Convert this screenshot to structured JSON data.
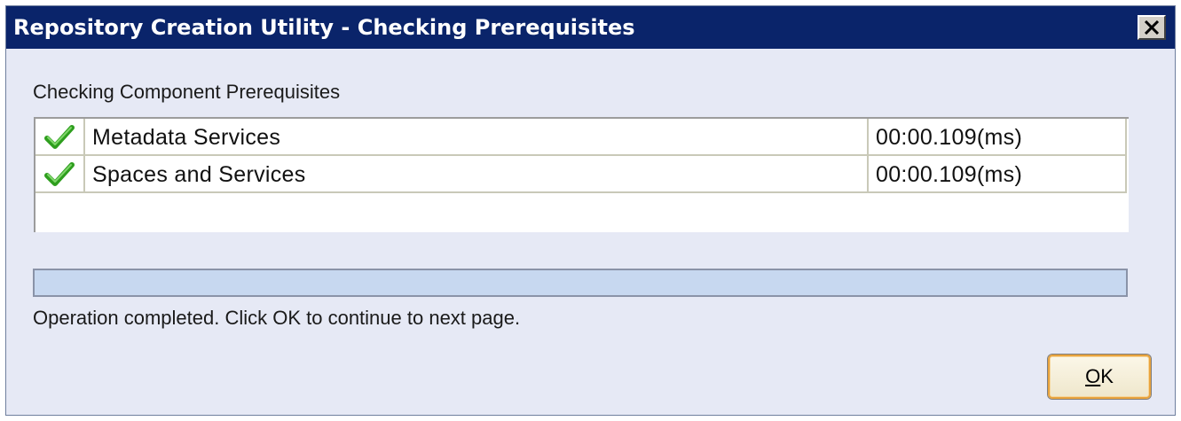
{
  "window": {
    "title": "Repository Creation Utility - Checking Prerequisites",
    "close_icon": "close-icon"
  },
  "section": {
    "label": "Checking Component Prerequisites"
  },
  "components": [
    {
      "status_icon": "checkmark-icon",
      "status": "passed",
      "name": "Metadata Services",
      "time": "00:00.109(ms)"
    },
    {
      "status_icon": "checkmark-icon",
      "status": "passed",
      "name": "Spaces and Services",
      "time": "00:00.109(ms)"
    }
  ],
  "progress": {
    "percent": 100
  },
  "status_message": "Operation completed. Click OK to continue to next page.",
  "buttons": {
    "ok_label": "OK",
    "ok_mnemonic": "O"
  },
  "colors": {
    "titlebar": "#0a246a",
    "dialog_background": "#e6e9f5",
    "progress_fill": "#c7d8f0",
    "check_green": "#2e9e1e",
    "ok_border": "#e8a33d"
  }
}
